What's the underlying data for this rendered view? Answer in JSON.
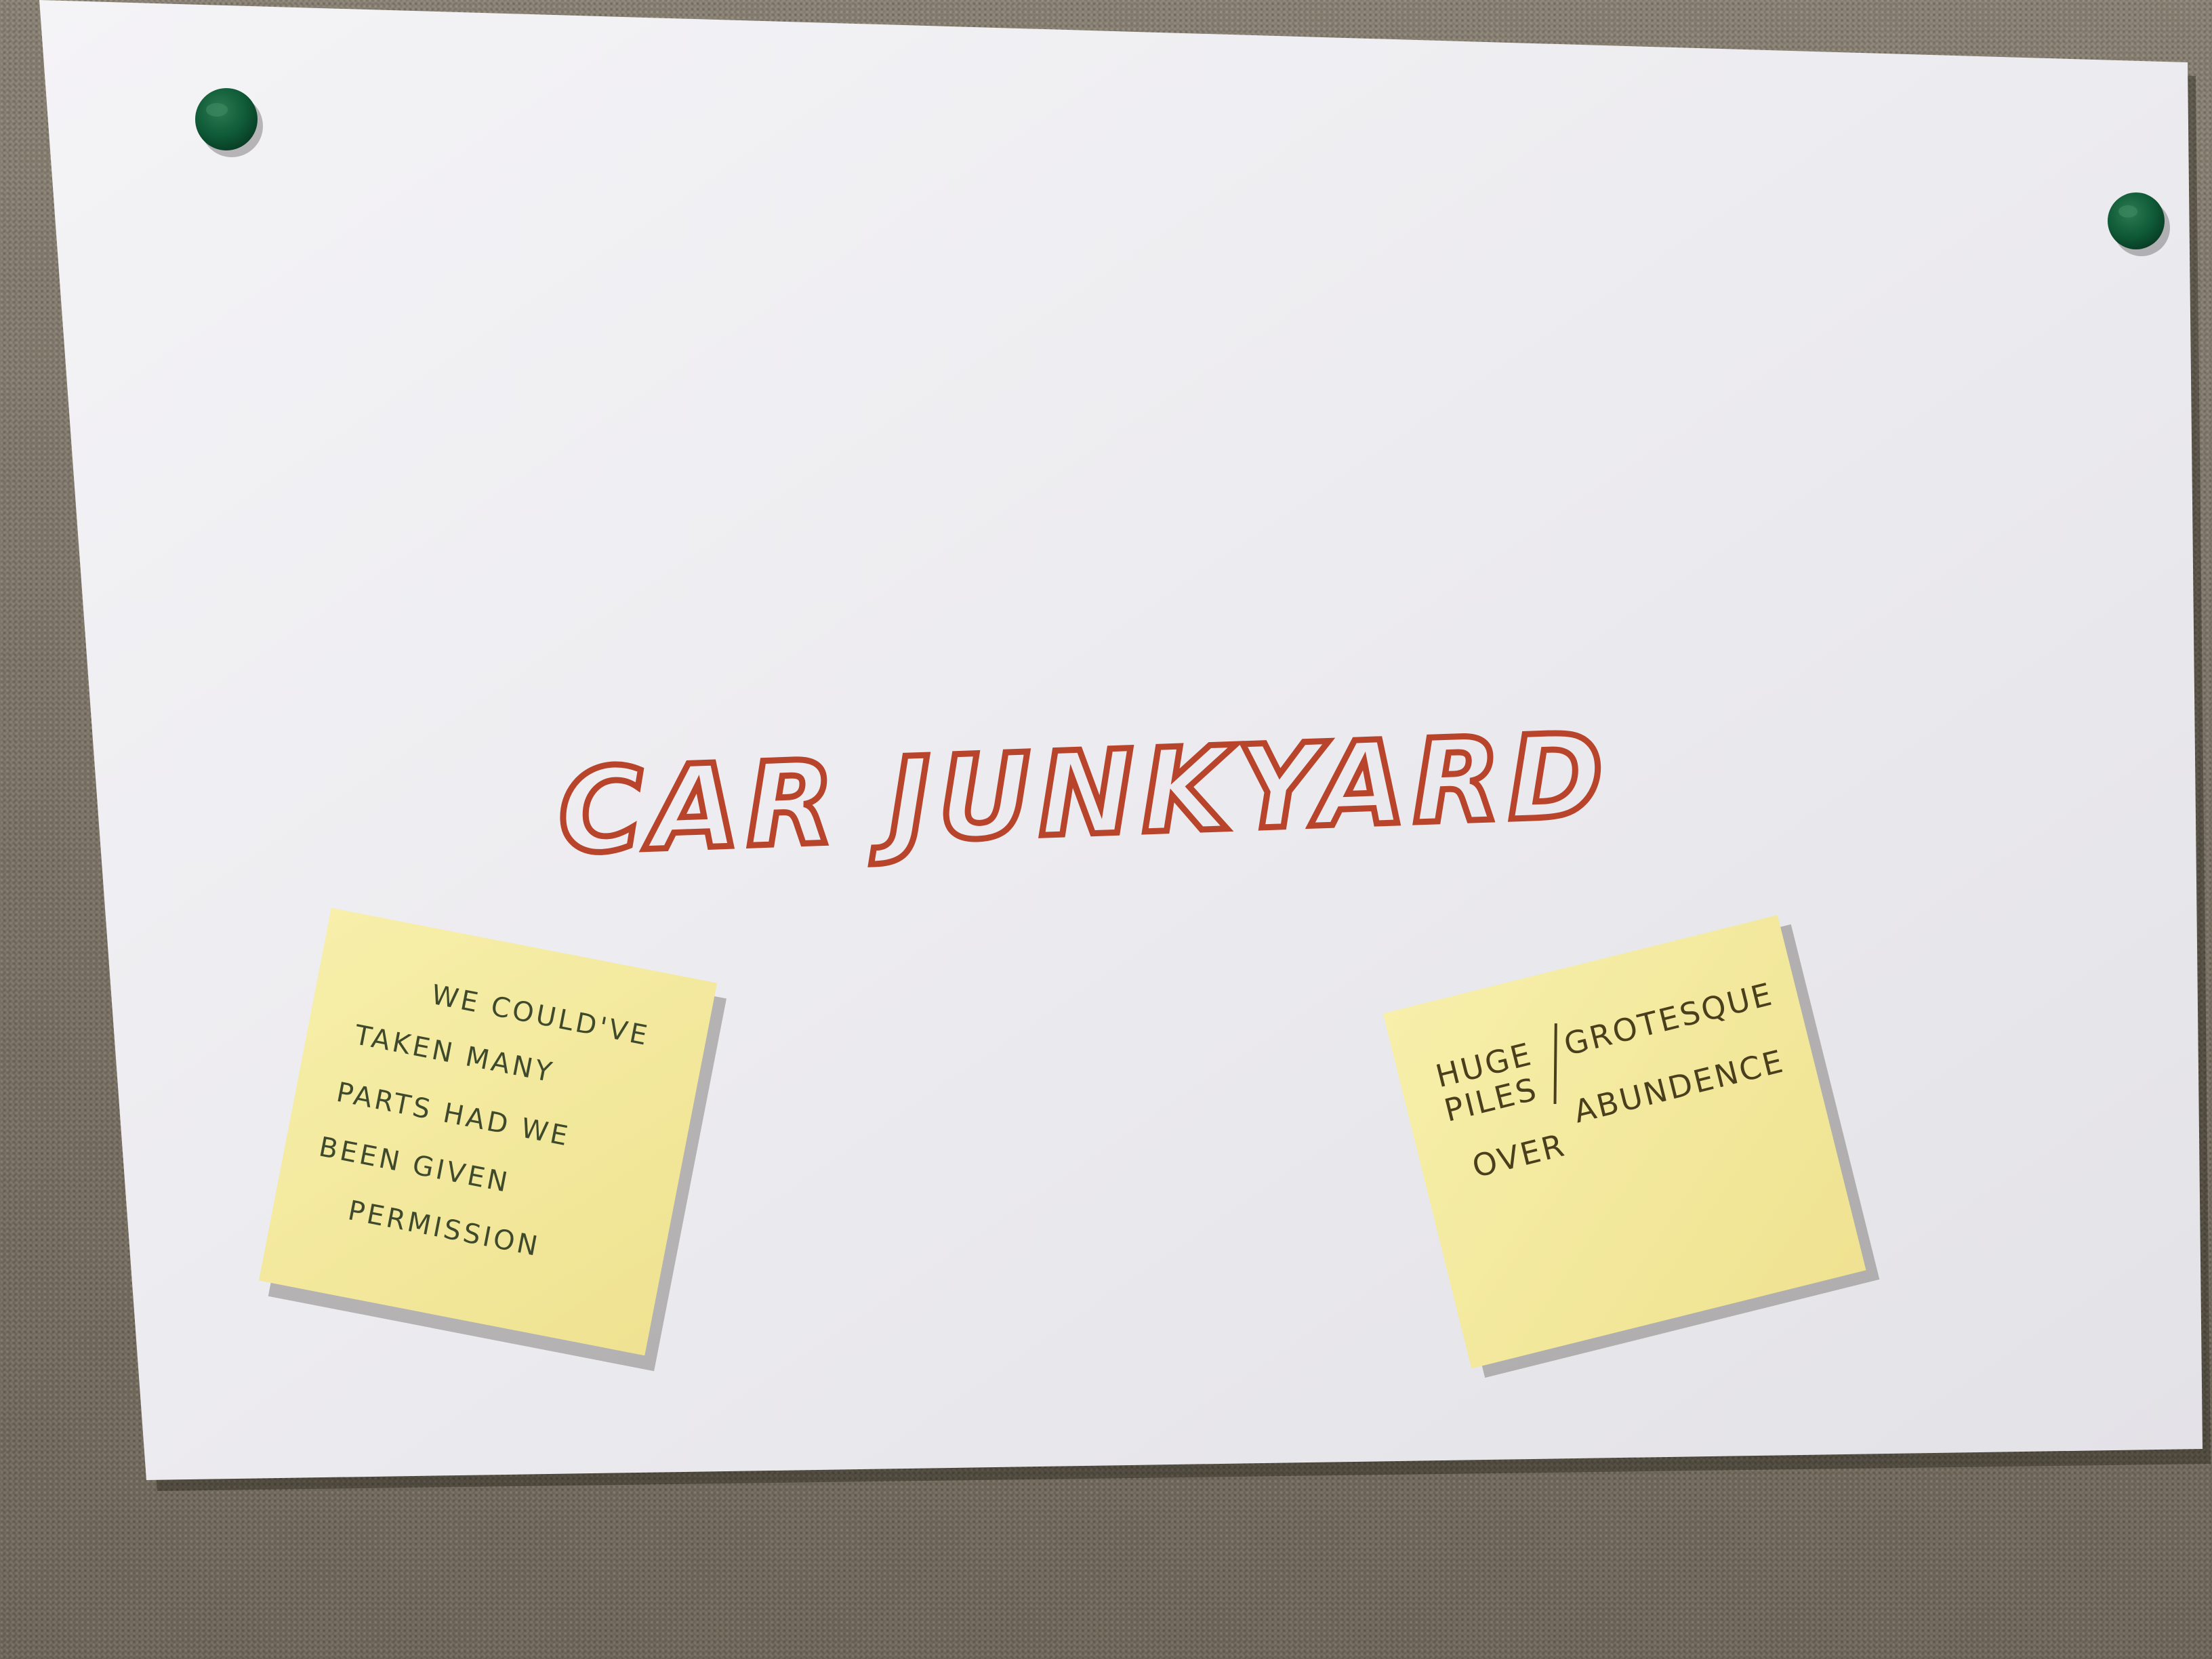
{
  "sign": {
    "title": "CAR JUNKYARD"
  },
  "left_note": {
    "lines": [
      "WE COULD'VE",
      "TAKEN MANY",
      "PARTS HAD WE",
      "BEEN GIVEN",
      "PERMISSION"
    ]
  },
  "right_note": {
    "line1_left": "HUGE",
    "line2_left": "PILES",
    "line1_right": "GROTESQUE",
    "line2_left_b": "OVER",
    "line2_right": "ABUNDENCE"
  },
  "colors": {
    "corkboard": "#7d7466",
    "paper": "#efeef0",
    "marker": "#b8442c",
    "sticky_note": "#f4ea9e",
    "pushpin": "#0f5a37"
  },
  "icons": [
    "pushpin-icon",
    "pushpin-icon"
  ]
}
